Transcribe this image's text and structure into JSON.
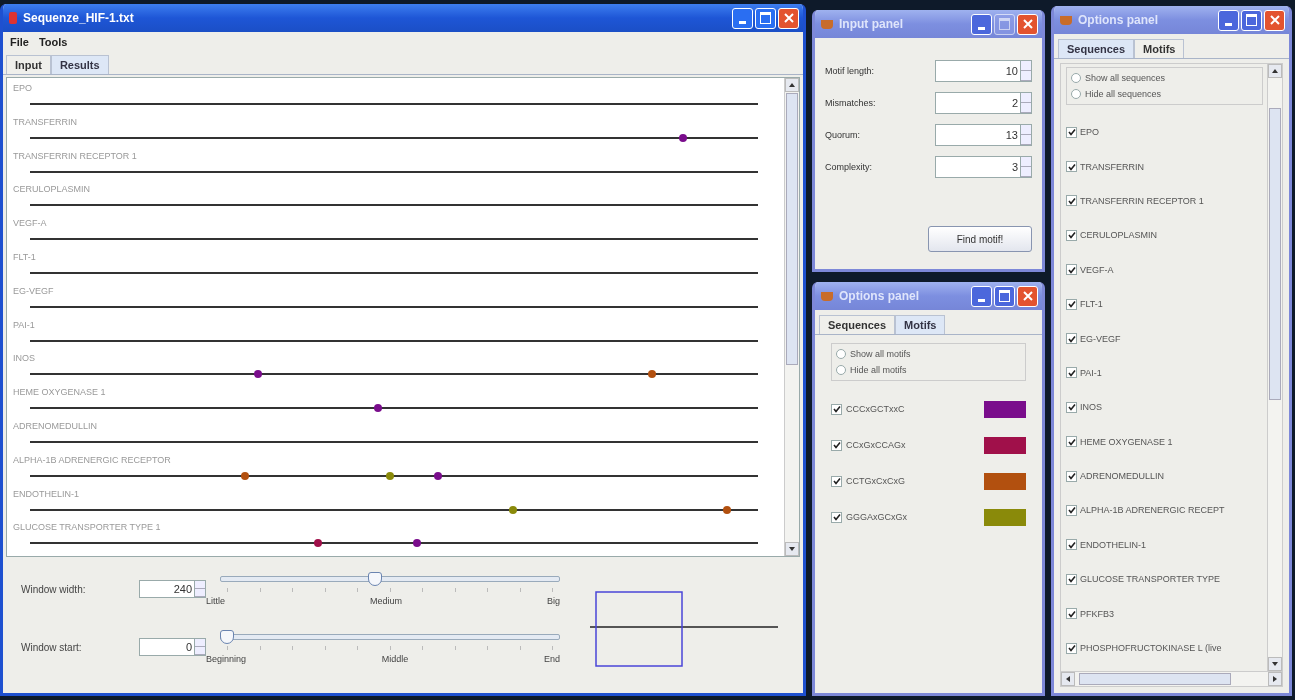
{
  "main_window": {
    "title": "Sequenze_HIF-1.txt",
    "menu": [
      "File",
      "Tools"
    ],
    "tabs": [
      {
        "label": "Input",
        "selected": false
      },
      {
        "label": "Results",
        "selected": true
      }
    ],
    "sequences": [
      {
        "name": "EPO"
      },
      {
        "name": "TRANSFERRIN",
        "hits": [
          {
            "level": 0.897,
            "color": "#7a0d8c"
          }
        ]
      },
      {
        "name": "TRANSFERRIN RECEPTOR 1"
      },
      {
        "name": "CERULOPLASMIN"
      },
      {
        "name": "VEGF-A"
      },
      {
        "name": "FLT-1"
      },
      {
        "name": "EG-VEGF"
      },
      {
        "name": "PAI-1"
      },
      {
        "name": "INOS",
        "hits": [
          {
            "level": 0.313,
            "color": "#7a0d8c"
          },
          {
            "level": 0.854,
            "color": "#b2500f"
          }
        ]
      },
      {
        "name": "HEME OXYGENASE 1",
        "hits": [
          {
            "level": 0.478,
            "color": "#7a0d8c"
          }
        ]
      },
      {
        "name": "ADRENOMEDULLIN"
      },
      {
        "name": "ALPHA-1B ADRENERGIC RECEPTOR",
        "hits": [
          {
            "level": 0.295,
            "color": "#b2500f"
          },
          {
            "level": 0.495,
            "color": "#8a8a0a"
          },
          {
            "level": 0.56,
            "color": "#7a0d8c"
          }
        ]
      },
      {
        "name": "ENDOTHELIN-1",
        "hits": [
          {
            "level": 0.663,
            "color": "#8a8a0a"
          },
          {
            "level": 0.957,
            "color": "#b2500f"
          }
        ]
      },
      {
        "name": "GLUCOSE TRANSPORTER TYPE 1",
        "hits": [
          {
            "level": 0.395,
            "color": "#a0104a"
          },
          {
            "level": 0.532,
            "color": "#7a0d8c"
          }
        ]
      }
    ],
    "controls": [
      {
        "label": "Window width:",
        "value": "240",
        "level": 0.455,
        "ticks": [
          "Little",
          "Medium",
          "Big"
        ]
      },
      {
        "label": "Window start:",
        "value": "0",
        "level": 0,
        "ticks": [
          "Beginning",
          "Middle",
          "End"
        ]
      }
    ]
  },
  "input_panel": {
    "title": "Input panel",
    "fields": [
      {
        "label": "Motif length:",
        "value": "10"
      },
      {
        "label": "Mismatches:",
        "value": "2"
      },
      {
        "label": "Quorum:",
        "value": "13"
      },
      {
        "label": "Complexity:",
        "value": "3"
      }
    ],
    "button": "Find motif!"
  },
  "options_motifs": {
    "title": "Options panel",
    "tabs": [
      {
        "label": "Sequences",
        "selected": false
      },
      {
        "label": "Motifs",
        "selected": true
      }
    ],
    "radios": [
      {
        "label": "Show all motifs",
        "selected": false
      },
      {
        "label": "Hide all motifs",
        "selected": false
      }
    ],
    "motifs": [
      {
        "pattern": "CCCxGCTxxC",
        "checked": true,
        "color": "#7a0d8c"
      },
      {
        "pattern": "CCxGxCCAGx",
        "checked": true,
        "color": "#a0104a"
      },
      {
        "pattern": "CCTGxCxCxG",
        "checked": true,
        "color": "#b2500f"
      },
      {
        "pattern": "GGGAxGCxGx",
        "checked": true,
        "color": "#8a8a0a"
      }
    ]
  },
  "options_sequences": {
    "title": "Options panel",
    "tabs": [
      {
        "label": "Sequences",
        "selected": true
      },
      {
        "label": "Motifs",
        "selected": false
      }
    ],
    "radios": [
      {
        "label": "Show all sequences",
        "selected": false
      },
      {
        "label": "Hide all sequences",
        "selected": false
      }
    ],
    "items": [
      {
        "label": "EPO",
        "checked": true
      },
      {
        "label": "TRANSFERRIN",
        "checked": true
      },
      {
        "label": "TRANSFERRIN RECEPTOR 1",
        "checked": true
      },
      {
        "label": "CERULOPLASMIN",
        "checked": true
      },
      {
        "label": "VEGF-A",
        "checked": true
      },
      {
        "label": "FLT-1",
        "checked": true
      },
      {
        "label": "EG-VEGF",
        "checked": true
      },
      {
        "label": "PAI-1",
        "checked": true
      },
      {
        "label": "INOS",
        "checked": true
      },
      {
        "label": "HEME OXYGENASE 1",
        "checked": true
      },
      {
        "label": "ADRENOMEDULLIN",
        "checked": true
      },
      {
        "label": "ALPHA-1B ADRENERGIC RECEPT",
        "checked": true
      },
      {
        "label": "ENDOTHELIN-1",
        "checked": true
      },
      {
        "label": "GLUCOSE TRANSPORTER TYPE",
        "checked": true
      },
      {
        "label": "PFKFB3",
        "checked": true
      },
      {
        "label": "PHOSPHOFRUCTOKINASE L (live",
        "checked": true
      }
    ]
  }
}
